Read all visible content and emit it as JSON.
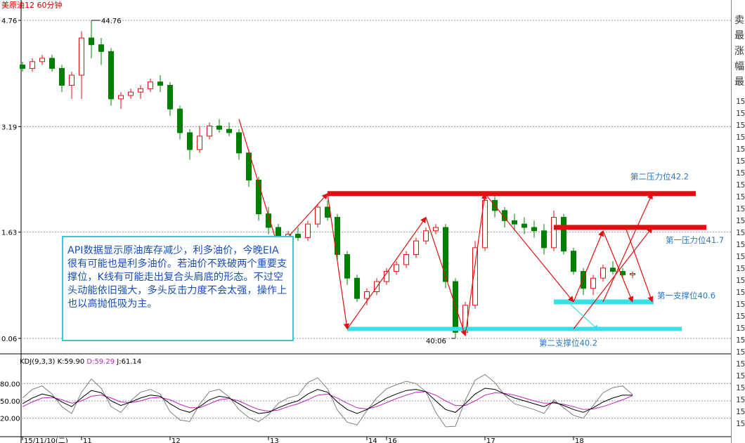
{
  "title": "美原油12  60分钟",
  "chart_data": {
    "type": "candlestick",
    "ylim": [
      40.06,
      44.76
    ],
    "y_ticks": [
      {
        "value": 44.76,
        "label": "4.76"
      },
      {
        "value": 43.19,
        "label": "3.19"
      },
      {
        "value": 41.63,
        "label": "1.63"
      },
      {
        "value": 40.06,
        "label": "0.06"
      }
    ],
    "x_ticks": [
      {
        "index": 0,
        "label": "15/11/10(二)"
      },
      {
        "index": 6,
        "label": "11"
      },
      {
        "index": 15,
        "label": "12"
      },
      {
        "index": 25,
        "label": "13"
      },
      {
        "index": 35,
        "label": "14"
      },
      {
        "index": 37,
        "label": "16"
      },
      {
        "index": 47,
        "label": "17"
      },
      {
        "index": 56,
        "label": "18"
      }
    ],
    "high_label": "44.76",
    "low_label": "40:06",
    "candles": [
      [
        44.1,
        44.15,
        44.0,
        44.05
      ],
      [
        44.05,
        44.2,
        44.0,
        44.15
      ],
      [
        44.15,
        44.25,
        44.1,
        44.2
      ],
      [
        44.2,
        44.25,
        44.0,
        44.05
      ],
      [
        44.05,
        44.1,
        43.7,
        43.8
      ],
      [
        43.8,
        44.0,
        43.6,
        43.95
      ],
      [
        43.95,
        44.6,
        43.6,
        44.5
      ],
      [
        44.5,
        44.76,
        44.2,
        44.4
      ],
      [
        44.4,
        44.5,
        44.1,
        44.3
      ],
      [
        44.3,
        44.35,
        43.5,
        43.6
      ],
      [
        43.6,
        43.7,
        43.45,
        43.65
      ],
      [
        43.65,
        43.75,
        43.6,
        43.7
      ],
      [
        43.7,
        43.8,
        43.6,
        43.75
      ],
      [
        43.75,
        43.9,
        43.7,
        43.85
      ],
      [
        43.85,
        43.95,
        43.7,
        43.8
      ],
      [
        43.8,
        43.85,
        43.35,
        43.45
      ],
      [
        43.45,
        43.5,
        43.0,
        43.1
      ],
      [
        43.1,
        43.15,
        42.7,
        42.85
      ],
      [
        42.85,
        43.2,
        42.8,
        43.05
      ],
      [
        43.05,
        43.25,
        43.0,
        43.2
      ],
      [
        43.2,
        43.3,
        43.1,
        43.15
      ],
      [
        43.15,
        43.25,
        43.05,
        43.1
      ],
      [
        43.1,
        43.15,
        42.7,
        42.8
      ],
      [
        42.8,
        42.85,
        42.3,
        42.4
      ],
      [
        42.4,
        42.45,
        41.8,
        41.9
      ],
      [
        41.9,
        42.0,
        41.6,
        41.7
      ],
      [
        41.7,
        41.75,
        41.45,
        41.5
      ],
      [
        41.5,
        41.65,
        41.45,
        41.6
      ],
      [
        41.6,
        41.7,
        41.5,
        41.55
      ],
      [
        41.55,
        41.8,
        41.5,
        41.75
      ],
      [
        41.75,
        42.05,
        41.7,
        42.0
      ],
      [
        42.0,
        42.1,
        41.8,
        41.85
      ],
      [
        41.85,
        41.9,
        41.2,
        41.3
      ],
      [
        41.3,
        41.35,
        40.85,
        40.95
      ],
      [
        40.95,
        41.0,
        40.6,
        40.65
      ],
      [
        40.65,
        40.8,
        40.55,
        40.75
      ],
      [
        40.75,
        40.95,
        40.7,
        40.9
      ],
      [
        40.9,
        41.1,
        40.85,
        41.05
      ],
      [
        41.05,
        41.2,
        41.0,
        41.15
      ],
      [
        41.15,
        41.35,
        41.1,
        41.3
      ],
      [
        41.3,
        41.55,
        41.25,
        41.5
      ],
      [
        41.5,
        41.7,
        41.45,
        41.65
      ],
      [
        41.65,
        41.75,
        41.6,
        41.7
      ],
      [
        41.7,
        41.75,
        40.8,
        40.9
      ],
      [
        40.9,
        40.95,
        40.06,
        40.15
      ],
      [
        40.15,
        40.6,
        40.1,
        40.55
      ],
      [
        40.55,
        41.5,
        40.5,
        41.4
      ],
      [
        41.4,
        42.2,
        41.35,
        42.1
      ],
      [
        42.1,
        42.2,
        41.85,
        41.95
      ],
      [
        41.95,
        42.0,
        41.7,
        41.8
      ],
      [
        41.8,
        41.9,
        41.65,
        41.75
      ],
      [
        41.75,
        41.85,
        41.6,
        41.7
      ],
      [
        41.7,
        41.8,
        41.55,
        41.65
      ],
      [
        41.65,
        41.75,
        41.3,
        41.4
      ],
      [
        41.4,
        41.95,
        41.35,
        41.85
      ],
      [
        41.85,
        41.9,
        41.3,
        41.35
      ],
      [
        41.35,
        41.4,
        41.0,
        41.05
      ],
      [
        41.05,
        41.1,
        40.7,
        40.8
      ],
      [
        40.8,
        41.0,
        40.7,
        40.95
      ],
      [
        40.95,
        41.15,
        40.9,
        41.1
      ],
      [
        41.1,
        41.2,
        41.0,
        41.05
      ],
      [
        41.05,
        41.1,
        40.95,
        41.0
      ],
      [
        41.0,
        41.05,
        40.95,
        41.02
      ]
    ],
    "lines": [
      {
        "label": "第二压力位42.2",
        "value": 42.2,
        "color": "#e01010"
      },
      {
        "label": "第一压力位41.7",
        "value": 41.7,
        "color": "#e01010"
      },
      {
        "label": "第一支撑位40.6",
        "value": 40.6,
        "color": "#38e0e8"
      },
      {
        "label": "第二支撑位40.2",
        "value": 40.2,
        "color": "#38e0e8"
      }
    ],
    "kdj": {
      "label": "KDJ(9,3,3)",
      "k_label": "K:59.90",
      "d_label": "D:59.29",
      "j_label": "J:61.14",
      "ylim": [
        0,
        100
      ],
      "y_ticks": [
        {
          "value": 80,
          "label": "80.00"
        },
        {
          "value": 50,
          "label": "50.00"
        },
        {
          "value": 20,
          "label": "20.00"
        }
      ],
      "k": [
        45,
        55,
        62,
        58,
        48,
        40,
        55,
        68,
        64,
        50,
        42,
        48,
        55,
        60,
        58,
        45,
        35,
        30,
        40,
        52,
        58,
        55,
        45,
        35,
        28,
        30,
        38,
        45,
        50,
        62,
        70,
        65,
        48,
        35,
        28,
        35,
        45,
        55,
        62,
        68,
        70,
        66,
        50,
        35,
        30,
        45,
        62,
        72,
        70,
        62,
        55,
        50,
        45,
        40,
        48,
        42,
        35,
        30,
        38,
        48,
        55,
        60,
        59.9
      ],
      "d": [
        40,
        48,
        55,
        56,
        52,
        46,
        50,
        58,
        60,
        55,
        48,
        47,
        50,
        55,
        56,
        52,
        44,
        38,
        38,
        45,
        52,
        54,
        50,
        42,
        35,
        32,
        34,
        40,
        45,
        52,
        60,
        62,
        55,
        46,
        38,
        36,
        40,
        47,
        54,
        60,
        65,
        66,
        60,
        50,
        42,
        42,
        50,
        60,
        64,
        63,
        60,
        55,
        50,
        46,
        46,
        44,
        40,
        35,
        36,
        40,
        46,
        52,
        59.29
      ],
      "j": [
        55,
        70,
        76,
        62,
        40,
        28,
        65,
        88,
        72,
        40,
        30,
        50,
        65,
        70,
        62,
        31,
        17,
        14,
        44,
        66,
        70,
        57,
        35,
        21,
        14,
        26,
        46,
        55,
        60,
        82,
        90,
        71,
        34,
        13,
        8,
        33,
        55,
        71,
        78,
        84,
        80,
        66,
        30,
        5,
        6,
        51,
        86,
        96,
        82,
        60,
        45,
        40,
        35,
        28,
        52,
        38,
        25,
        20,
        42,
        64,
        73,
        76,
        61.14
      ]
    }
  },
  "note": "API数据显示原油库存减少，利多油价，今晚EIA很有可能也是利多油价。若油价不跌破两个重要支撑位，K线有可能走出复合头肩底的形态。不过空头动能依旧强大，多头反击力度不会太强，操作上也以高抛低吸为主。",
  "colors": {
    "up": "#e01010",
    "down": "#008000",
    "resist": "#e01010",
    "support": "#38e0e8",
    "k": "#000000",
    "d": "#c020c0",
    "j": "#808080",
    "text": "#1a4fb4"
  },
  "side": {
    "chars": [
      "卖",
      "最",
      "涨",
      "幅",
      "最"
    ],
    "num": "15"
  }
}
